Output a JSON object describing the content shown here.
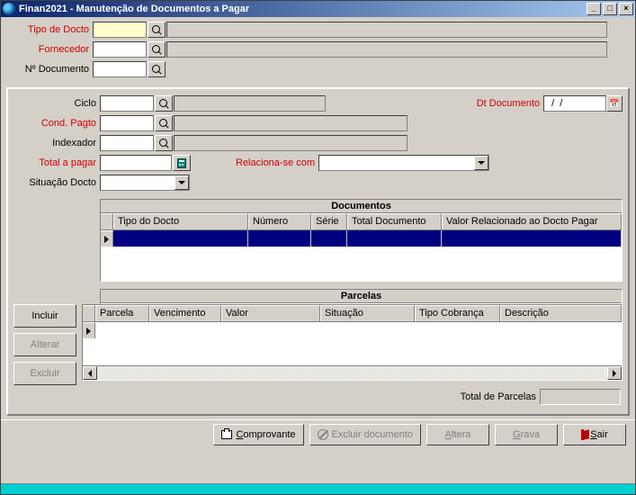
{
  "window": {
    "title": "Finan2021 - Manutenção de Documentos a Pagar"
  },
  "top": {
    "tipo_docto_label": "Tipo de Docto",
    "fornecedor_label": "Fornecedor",
    "num_doc_label": "Nº Documento"
  },
  "mid": {
    "ciclo_label": "Ciclo",
    "cond_pagto_label": "Cond. Pagto",
    "indexador_label": "Indexador",
    "total_pagar_label": "Total a pagar",
    "situacao_label": "Situação Docto",
    "dt_doc_label": "Dt Documento",
    "dt_doc_value": "  /  /",
    "relaciona_label": "Relaciona-se com"
  },
  "documentos": {
    "title": "Documentos",
    "cols": {
      "tipo": "Tipo do Docto",
      "numero": "Número",
      "serie": "Série",
      "total": "Total Documento",
      "valor_rel": "Valor Relacionado ao Docto Pagar"
    }
  },
  "parcelas": {
    "title": "Parcelas",
    "cols": {
      "parcela": "Parcela",
      "vencimento": "Vencimento",
      "valor": "Valor",
      "situacao": "Situação",
      "tipo_cobranca": "Tipo Cobrança",
      "descricao": "Descrição"
    },
    "buttons": {
      "incluir": "Incluir",
      "alterar": "Alterar",
      "excluir": "Excluir"
    },
    "total_label": "Total de Parcelas"
  },
  "actions": {
    "comprovante": "Comprovante",
    "excluir_doc": "Excluir documento",
    "altera": "Altera",
    "grava": "Grava",
    "sair": "Sair"
  }
}
